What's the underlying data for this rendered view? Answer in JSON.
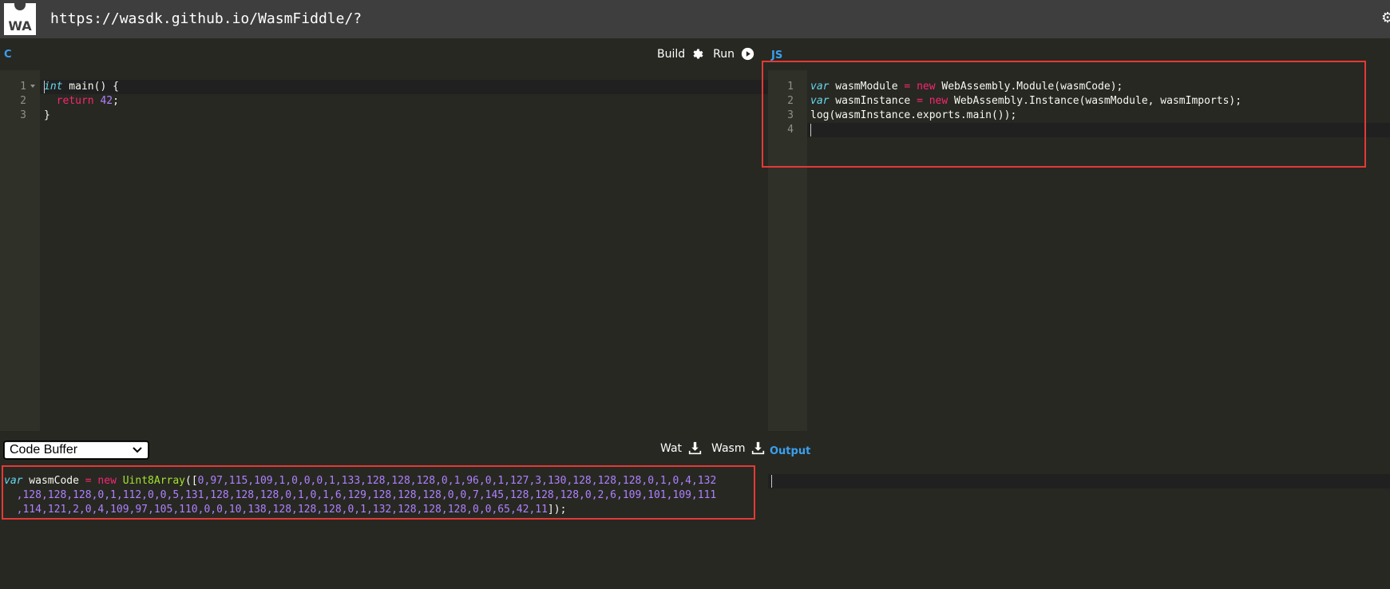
{
  "header": {
    "logo_text": "WA",
    "url": "https://wasdk.github.io/WasmFiddle/?"
  },
  "c_pane": {
    "title": "C",
    "build_label": "Build",
    "run_label": "Run",
    "line_numbers": [
      "1",
      "2",
      "3"
    ]
  },
  "js_pane": {
    "title": "JS",
    "line_numbers": [
      "1",
      "2",
      "3",
      "4"
    ],
    "code": {
      "l1_kw": "var",
      "l1_a": " wasmModule ",
      "l1_eq": "=",
      "l1_sp": " ",
      "l1_new": "new",
      "l1_b": " WebAssembly.Module(wasmCode);",
      "l2_kw": "var",
      "l2_a": " wasmInstance ",
      "l2_eq": "=",
      "l2_sp": " ",
      "l2_new": "new",
      "l2_b": " WebAssembly.Instance(wasmModule, wasmImports);",
      "l3": "log(wasmInstance.exports.main());"
    }
  },
  "c_code": {
    "l1_type": "int",
    "l1_rest": " main() {",
    "l2_indent": "  ",
    "l2_kw": "return",
    "l2_sp": " ",
    "l2_num": "42",
    "l2_end": ";",
    "l3": "}"
  },
  "bottom": {
    "select_value": "Code Buffer",
    "wat_label": "Wat",
    "wasm_label": "Wasm",
    "output_title": "Output"
  },
  "buffer": {
    "prefix_kw": "var",
    "prefix_name": " wasmCode ",
    "prefix_eq": "=",
    "prefix_sp": " ",
    "prefix_new": "new",
    "prefix_sp2": " ",
    "prefix_fn": "Uint8Array",
    "prefix_open": "([",
    "line1_nums": "0,97,115,109,1,0,0,0,1,133,128,128,128,0,1,96,0,1,127,3,130,128,128,128,0,1,0,4,132",
    "line2_nums": "  ,128,128,128,0,1,112,0,0,5,131,128,128,128,0,1,0,1,6,129,128,128,128,0,0,7,145,128,128,128,0,2,6,109,101,109,111",
    "line3_nums": "  ,114,121,2,0,4,109,97,105,110,0,0,10,138,128,128,128,0,1,132,128,128,128,0,0,65,42,11",
    "line3_close": "]);"
  },
  "icons": {
    "build": "gear-icon",
    "run": "play-circle-icon",
    "wat": "download-icon",
    "wasm": "download-icon",
    "select": "chevron-down-icon",
    "header_right": "gear-icon",
    "fold": "fold-arrow-icon"
  },
  "colors": {
    "header_bg": "#3e3e3e",
    "editor_bg": "#272822",
    "gutter_bg": "#2f3129",
    "pane_title": "#3aa0f0",
    "highlight": "#e53935",
    "keyword": "#f92672",
    "number": "#ae81ff",
    "type": "#66d9ef",
    "function": "#a6e22e"
  }
}
